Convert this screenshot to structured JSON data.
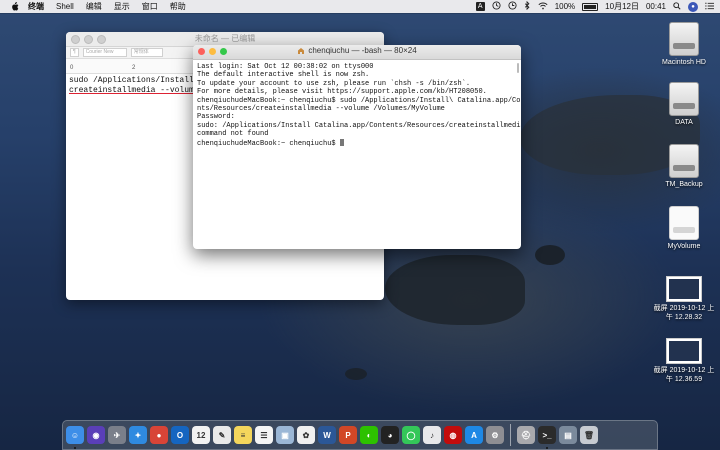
{
  "menubar": {
    "app_name": "终端",
    "items": [
      "Shell",
      "编辑",
      "显示",
      "窗口",
      "帮助"
    ],
    "status": {
      "input_source": "A",
      "battery_percent": "100%",
      "date": "10月12日",
      "time": "00:41"
    }
  },
  "textedit": {
    "title": "未命名 — 已编辑",
    "toolbar": [
      "¶",
      "Courier New",
      "常规体"
    ],
    "ruler": [
      "0",
      "2",
      "4",
      "6"
    ],
    "lines": [
      "sudo /Applications/Install\\ ",
      "createinstallmedia --volume "
    ]
  },
  "terminal": {
    "title": "chenqiuchu — -bash — 80×24",
    "lines": [
      "Last login: Sat Oct 12 00:38:02 on ttys000",
      "",
      "The default interactive shell is now zsh.",
      "To update your account to use zsh, please run `chsh -s /bin/zsh`.",
      "For more details, please visit https://support.apple.com/kb/HT208050.",
      "chenqiuchudeMacBook:~ chenqiuchu$ sudo /Applications/Install\\ Catalina.app/Conte",
      "nts/Resources/createinstallmedia --volume /Volumes/MyVolume",
      "Password:",
      "sudo: /Applications/Install Catalina.app/Contents/Resources/createinstallmedia:",
      "command not found"
    ],
    "prompt": "chenqiuchudeMacBook:~ chenqiuchu$ "
  },
  "desktop": {
    "icons": [
      {
        "label": "Macintosh HD",
        "kind": "hdd-icon"
      },
      {
        "label": "DATA",
        "kind": "hdd-icon"
      },
      {
        "label": "TM_Backup",
        "kind": "hdd-icon"
      },
      {
        "label": "MyVolume",
        "kind": "hdd-icon"
      },
      {
        "label_1": "截屏 2019-10-12 上",
        "label_2": "午 12.28.32",
        "kind": "screenshot-icon"
      },
      {
        "label_1": "截屏 2019-10-12 上",
        "label_2": "午 12.36.59",
        "kind": "screenshot-icon"
      }
    ]
  },
  "dock": {
    "apps": [
      {
        "name": "finder-icon",
        "glyph": "☺",
        "color": "#3d8ee8"
      },
      {
        "name": "siri-icon",
        "glyph": "◉",
        "color": "#5a3fb8"
      },
      {
        "name": "launchpad-icon",
        "glyph": "✈",
        "color": "#7a7f8a"
      },
      {
        "name": "safari-icon",
        "glyph": "✦",
        "color": "#2f8ae0"
      },
      {
        "name": "chrome-icon",
        "glyph": "●",
        "color": "#d84437"
      },
      {
        "name": "outlook-icon",
        "glyph": "O",
        "color": "#1565c0"
      },
      {
        "name": "calendar-icon",
        "glyph": "12",
        "color": "#f2f2f2"
      },
      {
        "name": "pages-icon",
        "glyph": "✎",
        "color": "#e9e9e9"
      },
      {
        "name": "notes-icon",
        "glyph": "≡",
        "color": "#f4d65c"
      },
      {
        "name": "reminders-icon",
        "glyph": "☰",
        "color": "#f5f5f5"
      },
      {
        "name": "preview-icon",
        "glyph": "▣",
        "color": "#9bb7d6"
      },
      {
        "name": "photos-icon",
        "glyph": "✿",
        "color": "#f0f0f0"
      },
      {
        "name": "word-icon",
        "glyph": "W",
        "color": "#2b5797"
      },
      {
        "name": "powerpoint-icon",
        "glyph": "P",
        "color": "#d24726"
      },
      {
        "name": "wechat-icon",
        "glyph": "◐",
        "color": "#2dc100"
      },
      {
        "name": "qq-icon",
        "glyph": "◕",
        "color": "#222222"
      },
      {
        "name": "messages-icon",
        "glyph": "◯",
        "color": "#34c759"
      },
      {
        "name": "itunes-icon",
        "glyph": "♪",
        "color": "#e8e8ea"
      },
      {
        "name": "netease-music-icon",
        "glyph": "◍",
        "color": "#c20c0c"
      },
      {
        "name": "app-store-icon",
        "glyph": "A",
        "color": "#1e88e5"
      },
      {
        "name": "system-preferences-icon",
        "glyph": "⚙",
        "color": "#8e8e93"
      },
      {
        "name": "disk-utility-icon",
        "glyph": "⛑",
        "color": "#a9a9ad"
      },
      {
        "name": "terminal-icon",
        "glyph": ">_",
        "color": "#2b2b2b"
      },
      {
        "name": "folder-icon",
        "glyph": "▤",
        "color": "#7b8a9c"
      },
      {
        "name": "trash-icon",
        "glyph": "🗑",
        "color": "#c7cbd1"
      }
    ]
  }
}
